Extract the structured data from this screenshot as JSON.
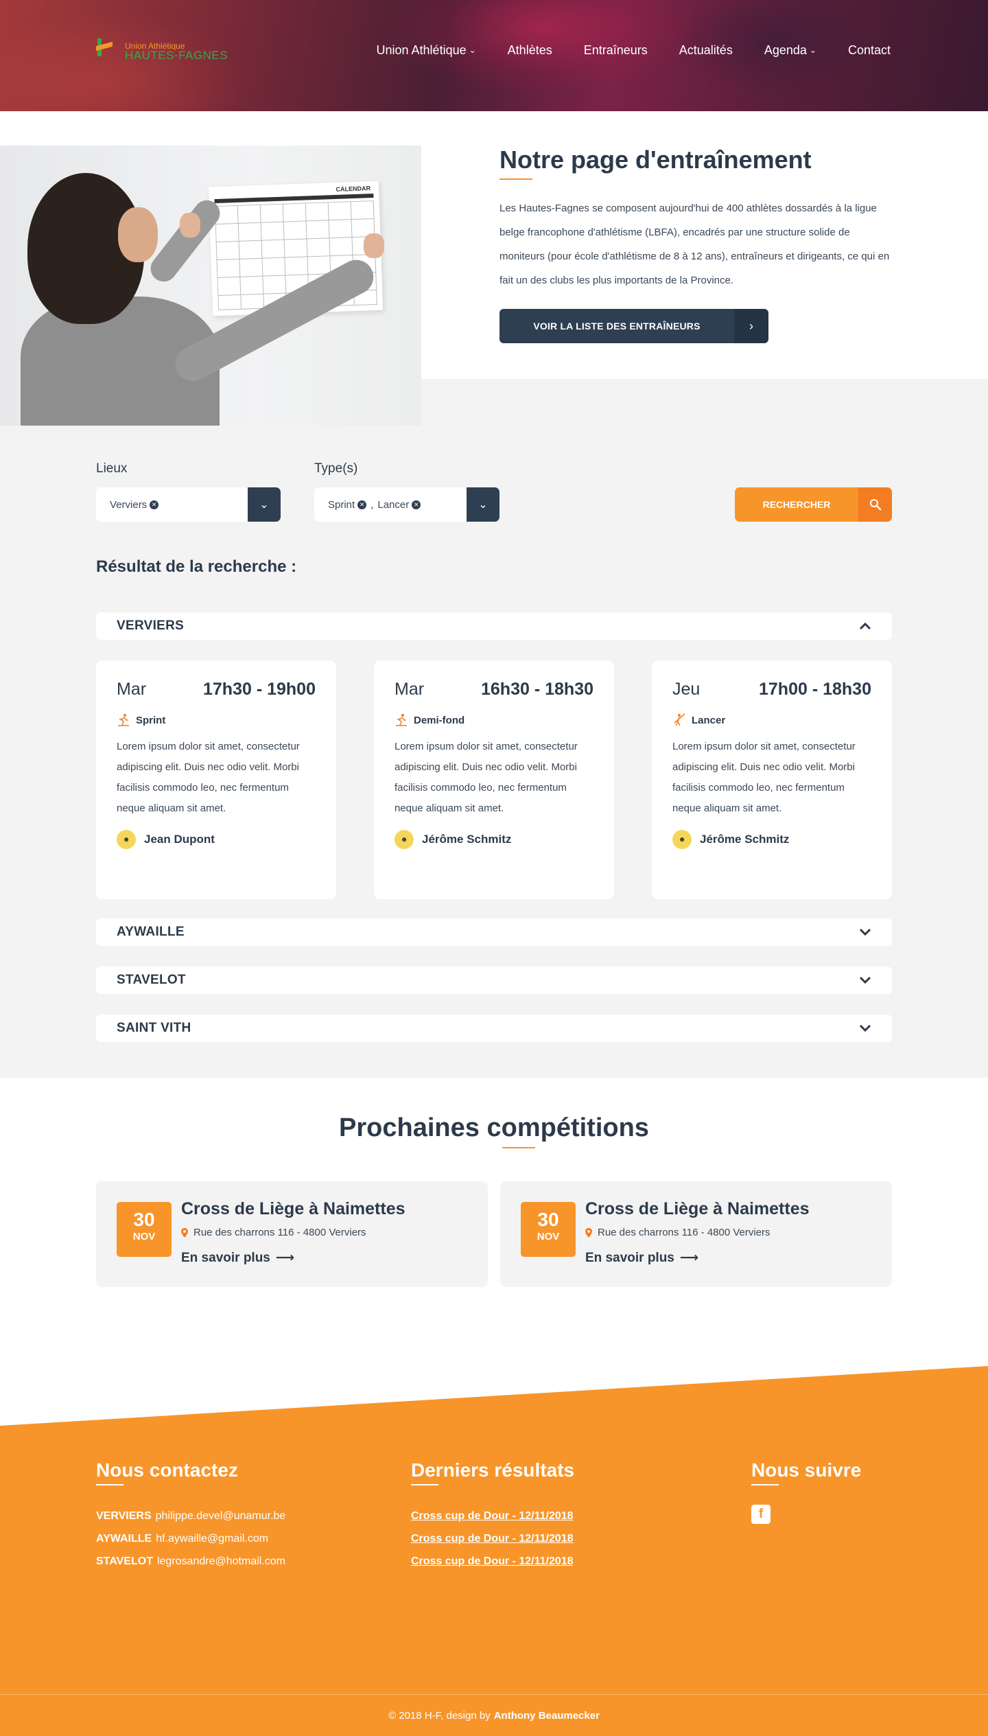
{
  "brand": {
    "logo_line1": "Union Athlétique",
    "logo_line2": "HAUTES-FAGNES",
    "accent": "#f7952a",
    "dark": "#2f3f52",
    "green": "#3aa64a"
  },
  "nav": {
    "items": [
      {
        "label": "Union Athlétique",
        "dropdown": true
      },
      {
        "label": "Athlètes",
        "dropdown": false
      },
      {
        "label": "Entraîneurs",
        "dropdown": false
      },
      {
        "label": "Actualités",
        "dropdown": false
      },
      {
        "label": "Agenda",
        "dropdown": true
      },
      {
        "label": "Contact",
        "dropdown": false
      }
    ]
  },
  "intro": {
    "title": "Notre page d'entraînement",
    "text": "Les Hautes-Fagnes se composent aujourd'hui de 400 athlètes dossardés à la ligue belge francophone d'athlétisme (LBFA), encadrés par une structure solide de moniteurs (pour école d'athlétisme de 8 à 12 ans), entraîneurs et dirigeants, ce qui en fait un des clubs les plus importants de la Province.",
    "button": "VOIR LA LISTE DES ENTRAÎNEURS",
    "calendar_title": "CALENDAR"
  },
  "search": {
    "lieux_label": "Lieux",
    "lieux_values": [
      "Verviers"
    ],
    "types_label": "Type(s)",
    "types_values": [
      "Sprint",
      "Lancer"
    ],
    "button": "RECHERCHER",
    "results_title": "Résultat de la recherche :"
  },
  "accordions": [
    {
      "name": "VERVIERS",
      "open": true
    },
    {
      "name": "AYWAILLE",
      "open": false
    },
    {
      "name": "STAVELOT",
      "open": false
    },
    {
      "name": "SAINT VITH",
      "open": false
    }
  ],
  "sessions": [
    {
      "day": "Mar",
      "time": "17h30 - 19h00",
      "type": "Sprint",
      "desc": "Lorem ipsum dolor sit amet, consectetur adipiscing  elit. Duis nec odio velit. Morbi facilisis commodo leo, nec fermentum neque aliquam sit amet.",
      "coach": "Jean Dupont"
    },
    {
      "day": "Mar",
      "time": "16h30 - 18h30",
      "type": "Demi-fond",
      "desc": "Lorem ipsum dolor sit amet, consectetur adipiscing  elit. Duis nec odio velit. Morbi facilisis commodo leo, nec fermentum neque aliquam sit amet.",
      "coach": "Jérôme Schmitz"
    },
    {
      "day": "Jeu",
      "time": "17h00 - 18h30",
      "type": "Lancer",
      "desc": "Lorem ipsum dolor sit amet, consectetur adipiscing  elit. Duis nec odio velit. Morbi facilisis commodo leo, nec fermentum neque aliquam sit amet.",
      "coach": "Jérôme Schmitz"
    }
  ],
  "competitions": {
    "title": "Prochaines compétitions",
    "items": [
      {
        "day": "30",
        "month": "NOV",
        "name": "Cross de Liège à Naimettes",
        "address": "Rue des charrons 116 - 4800 Verviers",
        "more": "En savoir plus"
      },
      {
        "day": "30",
        "month": "NOV",
        "name": "Cross de Liège à Naimettes",
        "address": "Rue des charrons 116 - 4800 Verviers",
        "more": "En savoir plus"
      }
    ]
  },
  "footer": {
    "contact_title": "Nous contactez",
    "contacts": [
      {
        "place": "VERVIERS",
        "email": "philippe.devel@unamur.be"
      },
      {
        "place": "AYWAILLE",
        "email": "hf.aywaille@gmail.com"
      },
      {
        "place": "STAVELOT",
        "email": "legrosandre@hotmail.com"
      }
    ],
    "results_title": "Derniers résultats",
    "results": [
      "Cross cup de Dour - 12/11/2018",
      "Cross cup de Dour - 12/11/2018",
      "Cross cup de Dour - 12/11/2018"
    ],
    "follow_title": "Nous suivre",
    "copyright": "© 2018 H-F, design by",
    "designer": "Anthony Beaumecker"
  }
}
